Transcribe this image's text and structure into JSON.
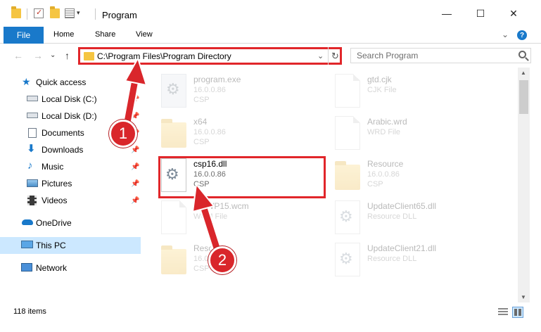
{
  "window": {
    "title": "Program",
    "minimize_label": "—",
    "maximize_label": "☐",
    "close_label": "✕"
  },
  "ribbon": {
    "tabs": [
      "File",
      "Home",
      "Share",
      "View"
    ],
    "help_label": "?",
    "chevron_label": "⌄"
  },
  "nav": {
    "back_label": "←",
    "forward_label": "→",
    "recent_label": "⌄",
    "up_label": "↑",
    "address": "C:\\Program Files\\Program Directory",
    "address_dropdown": "⌄",
    "refresh_label": "↻",
    "search_placeholder": "Search Program"
  },
  "sidebar": {
    "items": [
      {
        "label": "Quick access",
        "icon": "star-icon",
        "pinned": false
      },
      {
        "label": "Local Disk (C:)",
        "icon": "drive-icon",
        "pinned": true
      },
      {
        "label": "Local Disk (D:)",
        "icon": "drive-icon",
        "pinned": true
      },
      {
        "label": "Documents",
        "icon": "documents-icon",
        "pinned": true
      },
      {
        "label": "Downloads",
        "icon": "downloads-icon",
        "pinned": true
      },
      {
        "label": "Music",
        "icon": "music-icon",
        "pinned": true
      },
      {
        "label": "Pictures",
        "icon": "pictures-icon",
        "pinned": true
      },
      {
        "label": "Videos",
        "icon": "videos-icon",
        "pinned": true
      },
      {
        "label": "OneDrive",
        "icon": "cloud-icon",
        "pinned": false
      },
      {
        "label": "This PC",
        "icon": "computer-icon",
        "pinned": false,
        "selected": true
      },
      {
        "label": "Network",
        "icon": "network-icon",
        "pinned": false
      }
    ],
    "pin_glyph": "📌"
  },
  "files": [
    {
      "name": "program.exe",
      "meta1": "16.0.0.86",
      "meta2": "CSP",
      "icon": "exe-icon",
      "faded": true
    },
    {
      "name": "gtd.cjk",
      "meta1": "CJK File",
      "meta2": "",
      "icon": "document-icon",
      "faded": true
    },
    {
      "name": "x64",
      "meta1": "16.0.0.86",
      "meta2": "CSP",
      "icon": "folder-icon",
      "faded": true
    },
    {
      "name": "Arabic.wrd",
      "meta1": "WRD File",
      "meta2": "",
      "icon": "document-icon",
      "faded": true
    },
    {
      "name": "csp16.dll",
      "meta1": "16.0.0.86",
      "meta2": "CSP",
      "icon": "gear-document-icon",
      "faded": false,
      "highlighted": true
    },
    {
      "name": "Resource",
      "meta1": "16.0.0.86",
      "meta2": "CSP",
      "icon": "folder-icon",
      "faded": true
    },
    {
      "name": "MSWP15.wcm",
      "meta1": "WCM File",
      "meta2": "",
      "icon": "document-icon",
      "faded": true
    },
    {
      "name": "UpdateClient65.dll",
      "meta1": "Resource DLL",
      "meta2": "",
      "icon": "gear-document-icon",
      "faded": true
    },
    {
      "name": "Resource",
      "meta1": "16.0.0.86",
      "meta2": "CSP",
      "icon": "folder-icon",
      "faded": true
    },
    {
      "name": "UpdateClient21.dll",
      "meta1": "Resource DLL",
      "meta2": "",
      "icon": "gear-document-icon",
      "faded": true
    }
  ],
  "status": {
    "item_count": "118 items"
  },
  "annotations": [
    {
      "number": "1"
    },
    {
      "number": "2"
    }
  ],
  "colors": {
    "accent": "#1979ca",
    "annotation_red": "#e1262a",
    "selection": "#cce8ff"
  }
}
